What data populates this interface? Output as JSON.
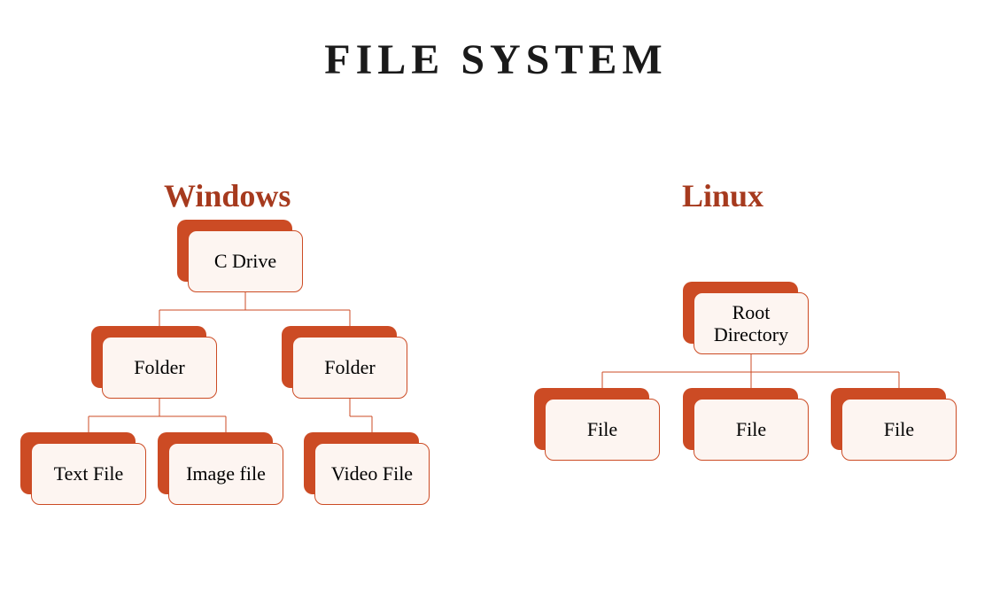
{
  "title": "FILE SYSTEM",
  "windows": {
    "heading": "Windows",
    "root": "C Drive",
    "folders": [
      "Folder",
      "Folder"
    ],
    "leaves": [
      "Text File",
      "Image file",
      "Video File"
    ]
  },
  "linux": {
    "heading": "Linux",
    "root": "Root Directory",
    "leaves": [
      "File",
      "File",
      "File"
    ]
  }
}
